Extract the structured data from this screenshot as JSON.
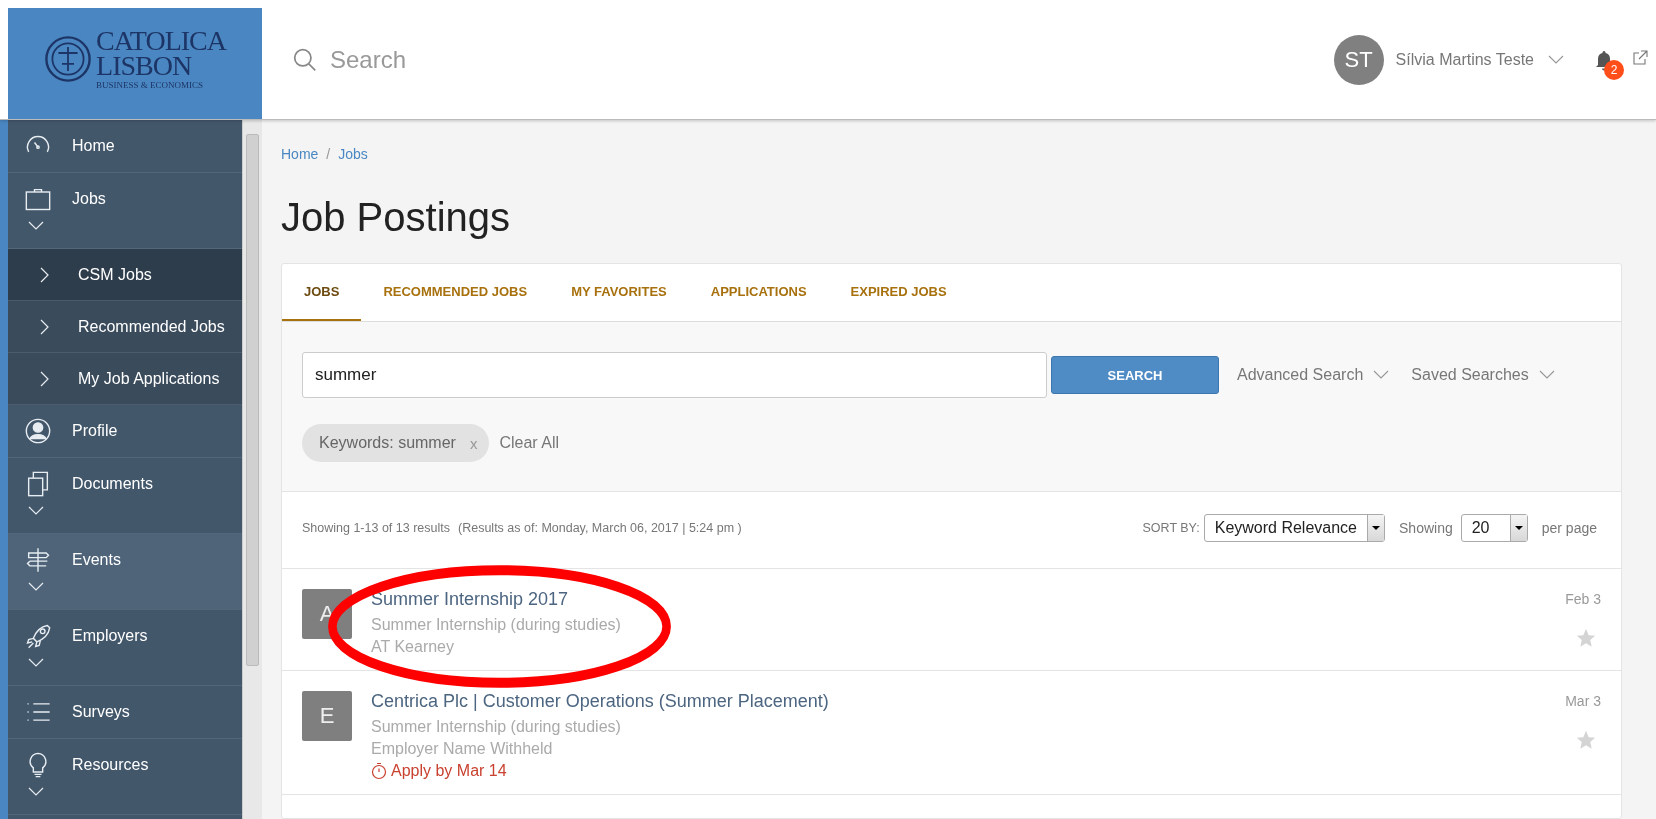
{
  "logo": {
    "line1": "CATOLICA",
    "line2": "LISBON",
    "tagline": "BUSINESS & ECONOMICS"
  },
  "header": {
    "search_placeholder": "Search",
    "user_initials": "ST",
    "user_name": "Sílvia Martins Teste",
    "notification_count": "2"
  },
  "sidebar": {
    "items": [
      {
        "label": "Home",
        "expandable": false,
        "selected": false,
        "hovered": false
      },
      {
        "label": "Jobs",
        "expandable": true,
        "selected": false,
        "hovered": false,
        "children": [
          {
            "label": "CSM Jobs",
            "selected": true
          },
          {
            "label": "Recommended Jobs",
            "selected": false
          },
          {
            "label": "My Job Applications",
            "selected": false
          }
        ]
      },
      {
        "label": "Profile",
        "expandable": false,
        "selected": false,
        "hovered": false
      },
      {
        "label": "Documents",
        "expandable": true,
        "selected": false,
        "hovered": false
      },
      {
        "label": "Events",
        "expandable": true,
        "selected": false,
        "hovered": true
      },
      {
        "label": "Employers",
        "expandable": true,
        "selected": false,
        "hovered": false
      },
      {
        "label": "Surveys",
        "expandable": false,
        "selected": false,
        "hovered": false
      },
      {
        "label": "Resources",
        "expandable": true,
        "selected": false,
        "hovered": false
      }
    ]
  },
  "breadcrumb": {
    "items": [
      "Home",
      "Jobs"
    ],
    "separator": "/"
  },
  "page_title": "Job Postings",
  "tabs": [
    {
      "label": "JOBS",
      "selected": true
    },
    {
      "label": "RECOMMENDED JOBS",
      "selected": false
    },
    {
      "label": "MY FAVORITES",
      "selected": false
    },
    {
      "label": "APPLICATIONS",
      "selected": false
    },
    {
      "label": "EXPIRED JOBS",
      "selected": false
    }
  ],
  "search": {
    "value": "summer",
    "button": "SEARCH",
    "advanced": "Advanced Search",
    "saved": "Saved Searches"
  },
  "filters": {
    "chips": [
      {
        "label": "Keywords: summer",
        "remove": "x"
      }
    ],
    "clear": "Clear All"
  },
  "results": {
    "summary": "Showing 1-13 of 13 results",
    "as_of": "(Results as of: Monday, March 06, 2017 | 5:24 pm )",
    "sort_label": "SORT BY:",
    "sort_value": "Keyword Relevance",
    "showing_label": "Showing",
    "per_page_value": "20",
    "per_page_label": "per page"
  },
  "jobs": [
    {
      "initial": "A",
      "title": "Summer Internship 2017",
      "type": "Summer Internship (during studies)",
      "employer": "AT Kearney",
      "date": "Feb 3",
      "favorite": false,
      "highlighted": true
    },
    {
      "initial": "E",
      "title": "Centrica Plc | Customer Operations (Summer Placement)",
      "type": "Summer Internship (during studies)",
      "employer": "Employer Name Withheld",
      "deadline": "Apply by Mar 14",
      "date": "Mar 3",
      "favorite": false
    }
  ]
}
